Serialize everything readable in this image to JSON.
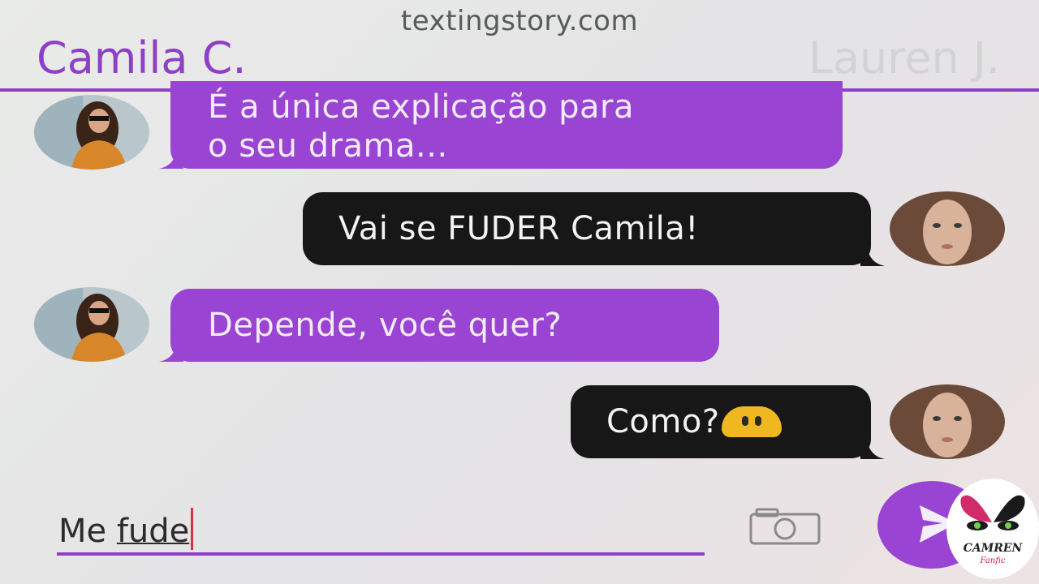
{
  "watermark": "textingstory.com",
  "header": {
    "left_contact": "Camila C.",
    "right_contact": "Lauren J."
  },
  "messages": [
    {
      "sender": "Camila C.",
      "side": "left",
      "lines": [
        "É a única explicação para",
        "o seu drama..."
      ]
    },
    {
      "sender": "Lauren J.",
      "side": "right",
      "text": "Vai se FUDER Camila!"
    },
    {
      "sender": "Camila C.",
      "side": "left",
      "text": "Depende, você quer?"
    },
    {
      "sender": "Lauren J.",
      "side": "right",
      "text": "Como?",
      "emoji": "yellow-blob-emoji"
    }
  ],
  "composer": {
    "text_prefix": "Me ",
    "text_underlined": "fude",
    "camera_icon": "camera-icon",
    "send_icon": "send-arrow-icon"
  },
  "logo": {
    "title": "CAMREN",
    "subtitle": "Fanfic"
  },
  "colors": {
    "accent": "#8e3fc8",
    "incoming_bubble": "#9a44d3",
    "outgoing_bubble": "#171717",
    "inactive_contact": "#d2d3d3"
  }
}
